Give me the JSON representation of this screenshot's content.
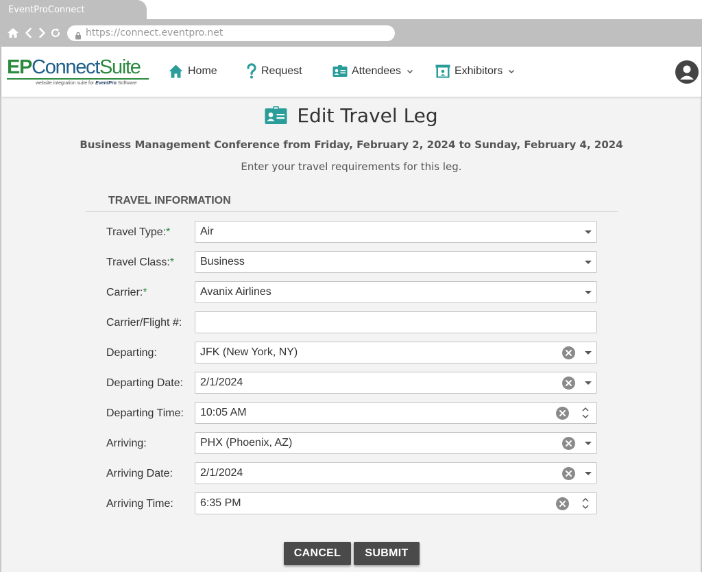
{
  "browser": {
    "tab_title": "EventProConnect",
    "url": "https://connect.eventpro.net"
  },
  "logo": {
    "ep": "EP",
    "connect": "Connect",
    "suite": "Suite",
    "tagline": "website integration suite for",
    "brand": "EventPro",
    "brand_suffix": "Software"
  },
  "nav": {
    "home": "Home",
    "request": "Request",
    "attendees": "Attendees",
    "exhibitors": "Exhibitors"
  },
  "page": {
    "title": "Edit Travel Leg",
    "event_line": "Business Management Conference from Friday, February 2, 2024 to Sunday, February 4, 2024",
    "instructions": "Enter your travel requirements for this leg."
  },
  "section": {
    "title": "TRAVEL INFORMATION"
  },
  "fields": {
    "travel_type": {
      "label": "Travel Type:",
      "required_mark": "*",
      "value": "Air"
    },
    "travel_class": {
      "label": "Travel Class:",
      "required_mark": "*",
      "value": "Business"
    },
    "carrier": {
      "label": "Carrier:",
      "required_mark": "*",
      "value": "Avanix Airlines"
    },
    "carrier_flight": {
      "label": "Carrier/Flight #:",
      "value": ""
    },
    "departing": {
      "label": "Departing:",
      "value": "JFK (New York, NY)"
    },
    "departing_date": {
      "label": "Departing Date:",
      "value": "2/1/2024"
    },
    "departing_time": {
      "label": "Departing Time:",
      "value": "10:05 AM"
    },
    "arriving": {
      "label": "Arriving:",
      "value": "PHX (Phoenix, AZ)"
    },
    "arriving_date": {
      "label": "Arriving Date:",
      "value": "2/1/2024"
    },
    "arriving_time": {
      "label": "Arriving Time:",
      "value": "6:35 PM"
    }
  },
  "buttons": {
    "cancel": "CANCEL",
    "submit": "SUBMIT"
  },
  "icons": {
    "home": "home-icon",
    "back": "back-arrow-icon",
    "forward": "forward-arrow-icon",
    "reload": "reload-icon",
    "lock": "lock-icon",
    "request": "question-mark-icon",
    "attendees": "id-badge-icon",
    "exhibitors": "booth-icon",
    "user": "user-avatar-icon",
    "clear": "clear-x-icon",
    "dropdown": "dropdown-caret-icon",
    "spinner": "spinner-icon"
  },
  "colors": {
    "accent_green": "#2b8a3e",
    "brand_blue": "#1e5f8a",
    "teal_icon": "#2a9d9a",
    "button_bg": "#4a4a4a"
  }
}
